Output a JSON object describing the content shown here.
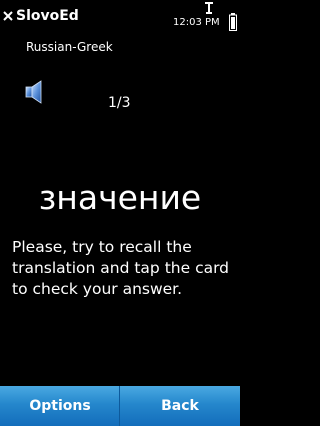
{
  "status_bar": {
    "app_title": "SlovoEd",
    "time": "12:03 PM",
    "close_icon": "close-icon",
    "signal_icon": "antenna-icon",
    "battery_icon": "battery-icon"
  },
  "header": {
    "language_pair": "Russian-Greek",
    "speaker_icon": "speaker-icon",
    "counter": "1/3"
  },
  "card": {
    "word": "значение",
    "instruction": "Please, try to recall the translation and tap the card to check your answer."
  },
  "softkeys": {
    "left_label": "Options",
    "right_label": "Back",
    "accent_color": "#2587cc"
  }
}
